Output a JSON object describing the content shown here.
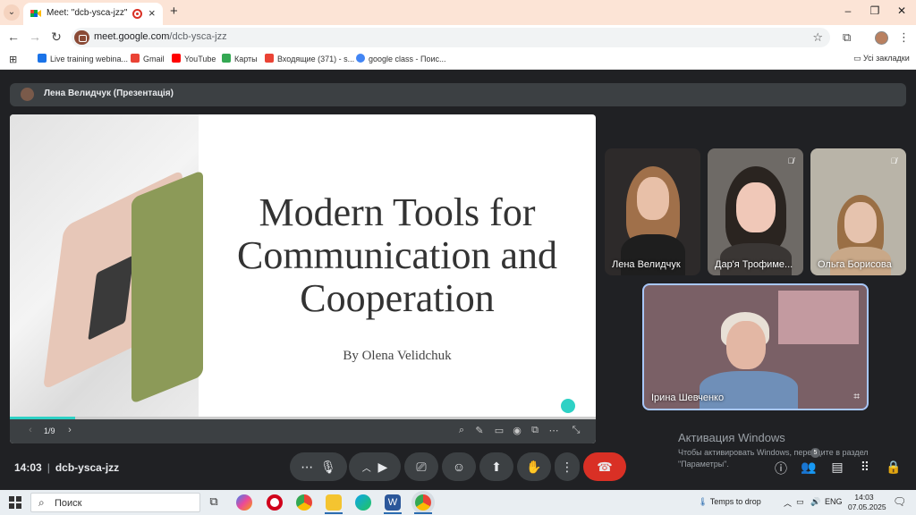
{
  "browser": {
    "tab_title": "Meet: \"dcb-ysca-jzz\"",
    "url_host": "meet.google.com",
    "url_path": "/dcb-ysca-jzz",
    "bookmarks": [
      {
        "label": "Live training webina...",
        "color": "#1a73e8"
      },
      {
        "label": "Gmail",
        "color": "#ea4335"
      },
      {
        "label": "YouTube",
        "color": "#ff0000"
      },
      {
        "label": "Карты",
        "color": "#34a853"
      },
      {
        "label": "Входящие (371) - s...",
        "color": "#ea4335"
      },
      {
        "label": "google class - Поис...",
        "color": "#4285f4"
      }
    ],
    "all_bookmarks": "Усі закладки"
  },
  "meet": {
    "presenter": "Лена Велидчук (Презентація)",
    "slide": {
      "title_lines": [
        "Modern Tools for",
        "Communication and",
        "Cooperation"
      ],
      "author": "By Olena Velidchuk",
      "page": "1/9",
      "progress": 0.111
    },
    "participants": [
      {
        "name": "Лена Велидчук",
        "muted": false
      },
      {
        "name": "Дар'я Трофиме...",
        "muted": true
      },
      {
        "name": "Ольга Борисова",
        "muted": true
      },
      {
        "name": "Ірина Шевченко",
        "muted": false
      }
    ],
    "time": "14:03",
    "meeting_code": "dcb-ysca-jzz",
    "participant_count": "5",
    "activation": {
      "title": "Активация Windows",
      "text": "Чтобы активировать Windows, перейдите в раздел \"Параметры\"."
    }
  },
  "taskbar": {
    "search_placeholder": "Поиск",
    "weather": "Temps to drop",
    "lang": "ENG",
    "time": "14:03",
    "date": "07.05.2025"
  }
}
